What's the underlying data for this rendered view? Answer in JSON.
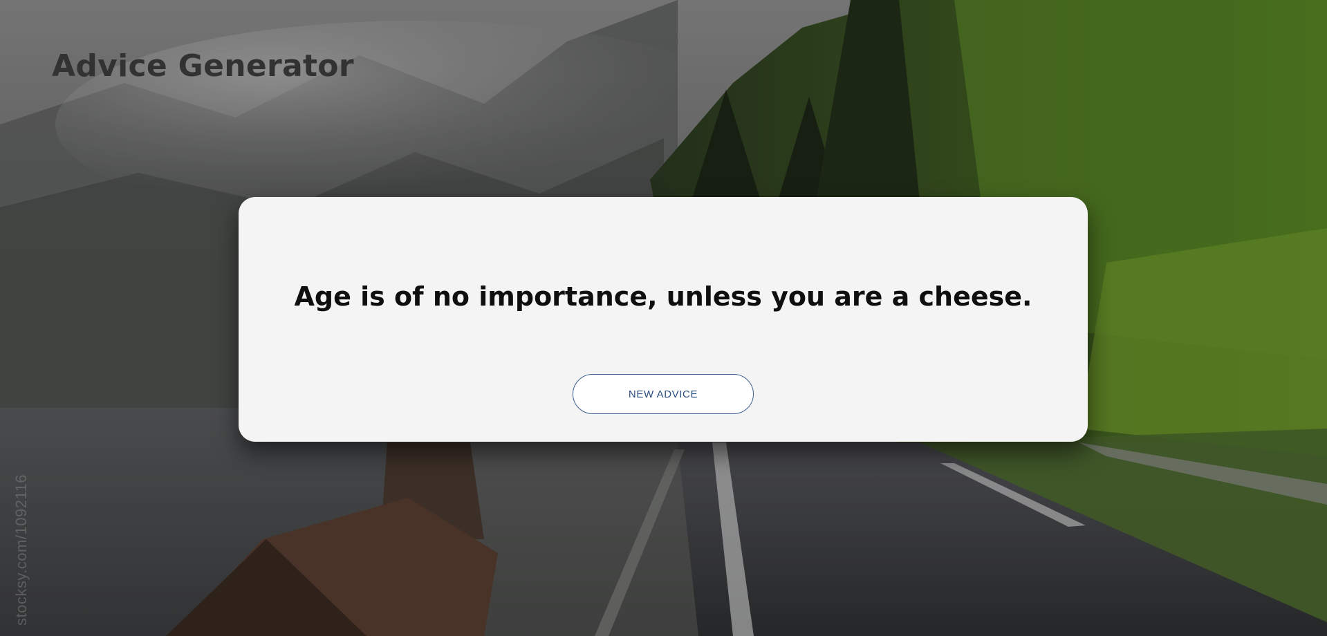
{
  "header": {
    "title": "Advice Generator"
  },
  "card": {
    "advice": "Age is of no importance, unless you are a cheese.",
    "button_label": "NEW ADVICE"
  },
  "background": {
    "watermark": "stocksy.com/1092116"
  },
  "colors": {
    "title": "#323232",
    "card_background": "#f4f4f4",
    "advice_text": "#0f0f0f",
    "button_border": "#3c5e90",
    "button_text": "#2c4f82"
  }
}
